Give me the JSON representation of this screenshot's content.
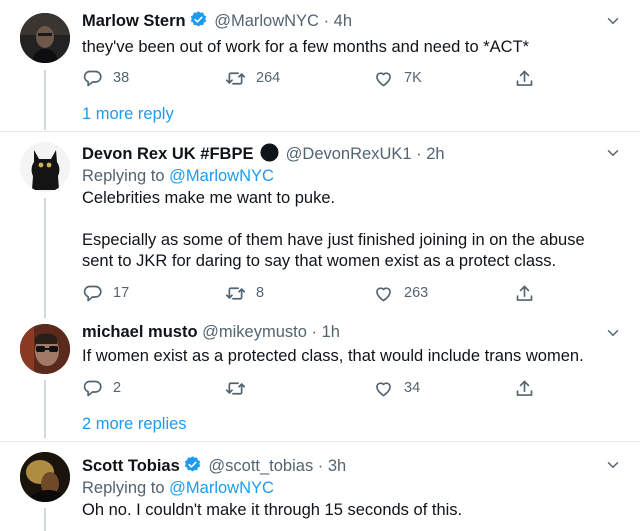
{
  "tweets": [
    {
      "name": "Marlow Stern",
      "verified": true,
      "handle": "@MarlowNYC",
      "time": "· 4h",
      "text": [
        "they've been out of work for a few months and need to *ACT*"
      ],
      "replies": "38",
      "retweets": "264",
      "likes": "7K",
      "more_replies": "1 more reply"
    },
    {
      "name": "Devon Rex UK #FBPE",
      "handle": "@DevonRexUK1",
      "time": "· 2h",
      "replying_label": "Replying to",
      "replying_to": "@MarlowNYC",
      "text": [
        "Celebrities make me want to puke.",
        "Especially as some of them have just finished joining in on the abuse",
        "sent to JKR for daring to say that women exist as a protect class."
      ],
      "replies": "17",
      "retweets": "8",
      "likes": "263"
    },
    {
      "name": "michael musto",
      "handle": "@mikeymusto",
      "time": "· 1h",
      "text": [
        "If women exist as a protected class, that would include trans women."
      ],
      "replies": "2",
      "retweets": "",
      "likes": "34",
      "more_replies": "2 more replies"
    },
    {
      "name": "Scott Tobias",
      "verified": true,
      "handle": "@scott_tobias",
      "time": "· 3h",
      "replying_label": "Replying to",
      "replying_to": "@MarlowNYC",
      "text": [
        "Oh no. I couldn't make it through 15 seconds of this."
      ]
    }
  ],
  "icons": {
    "reply": "reply-icon",
    "retweet": "retweet-icon",
    "like": "heart-icon",
    "share": "share-icon",
    "more": "chevron-down-icon",
    "verified": "verified-badge-icon"
  },
  "colors": {
    "link": "#1d9bf0",
    "muted": "#536471",
    "verified": "#1d9bf0",
    "line": "#cfd9de"
  }
}
